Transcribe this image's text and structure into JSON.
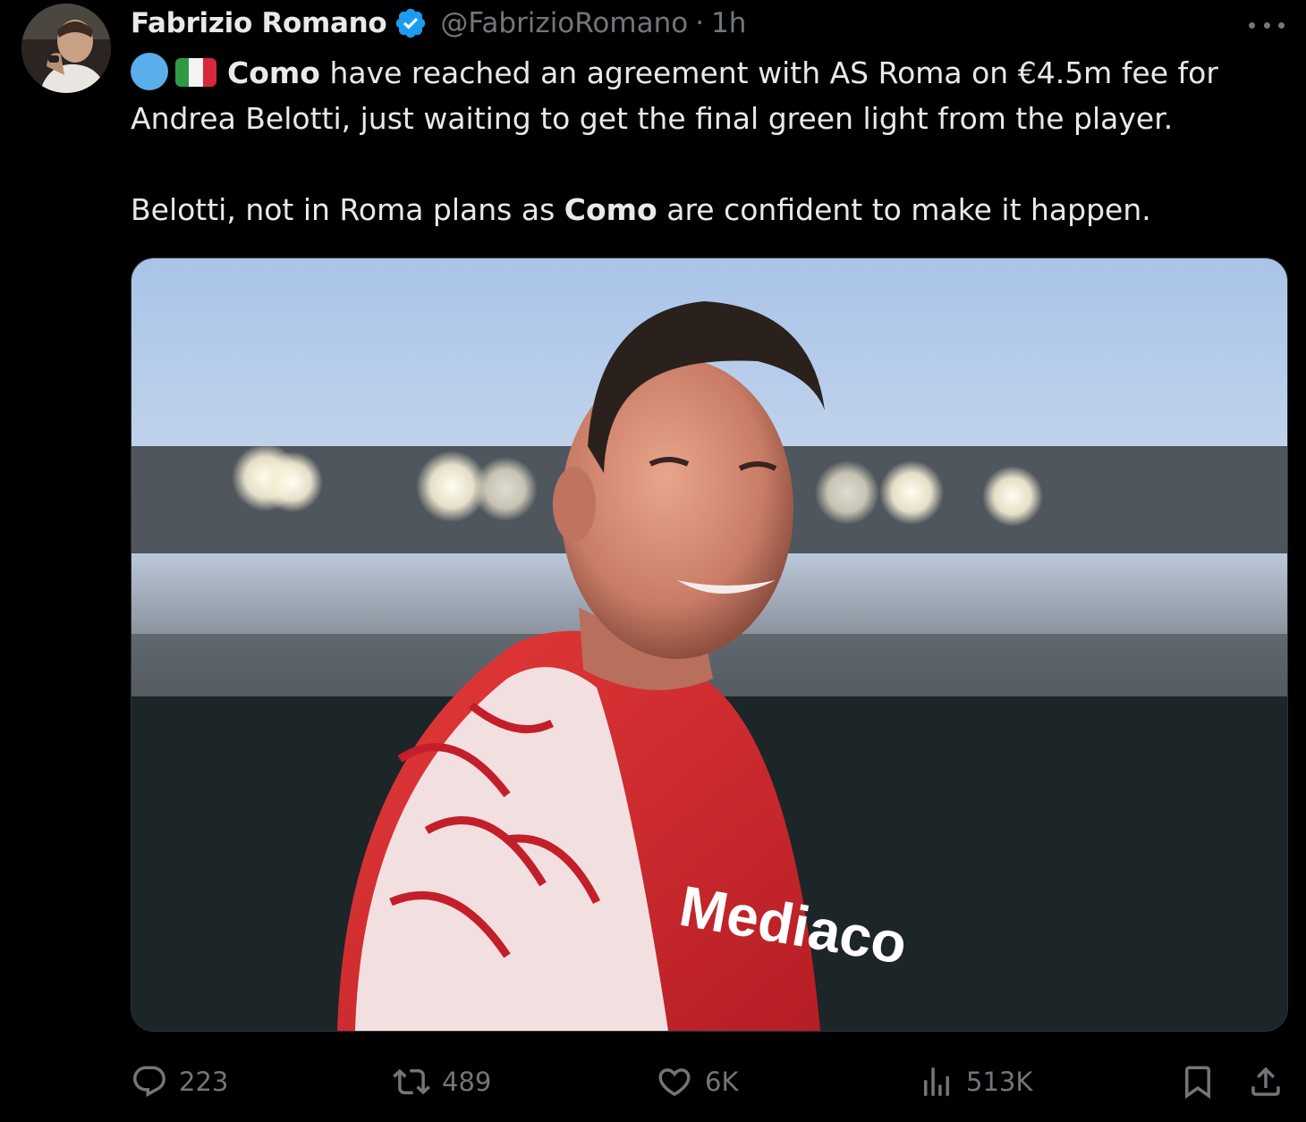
{
  "author": {
    "display_name": "Fabrizio Romano",
    "handle": "@FabrizioRomano",
    "separator": "·",
    "time": "1h",
    "verified": true,
    "verified_color": "#1d9bf0"
  },
  "tweet": {
    "paragraph1": {
      "emojis": [
        "blue-circle",
        "italy-flag"
      ],
      "bold1": "Como",
      "text1": " have reached an agreement with AS Roma on €4.5m fee for Andrea Belotti, just waiting to get the final green light from the player."
    },
    "paragraph2": {
      "text1": "Belotti, not in Roma plans as ",
      "bold1": "Como",
      "text2": " are confident to make it happen."
    }
  },
  "media": {
    "type": "photo"
  },
  "actions": {
    "replies": "223",
    "reposts": "489",
    "likes": "6K",
    "views": "513K",
    "reply_icon": "reply-icon",
    "repost_icon": "repost-icon",
    "like_icon": "heart-icon",
    "views_icon": "analytics-icon",
    "bookmark_icon": "bookmark-icon",
    "share_icon": "share-icon"
  },
  "colors": {
    "background": "#000000",
    "text_primary": "#e7e9ea",
    "text_secondary": "#71767b",
    "accent": "#1d9bf0"
  }
}
